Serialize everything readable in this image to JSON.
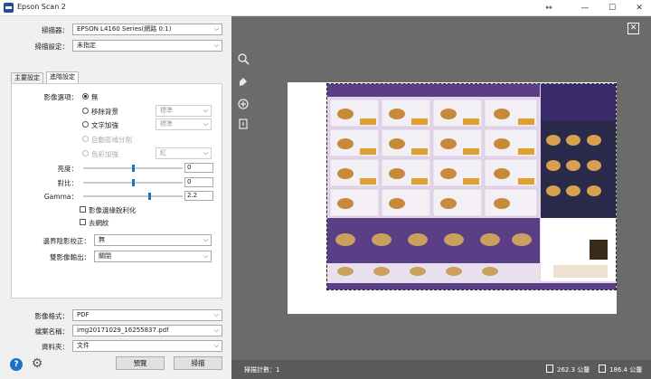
{
  "window": {
    "title": "Epson Scan 2",
    "pin_glyph": "↔",
    "minimize_glyph": "—",
    "maximize_glyph": "☐",
    "close_glyph": "✕"
  },
  "top_settings": {
    "scanner_label": "掃描器：",
    "scanner_value": "EPSON L4160 Series(網路 0:1)",
    "scan_settings_label": "掃描設定：",
    "scan_settings_value": "未指定"
  },
  "tabs": [
    {
      "label": "主要設定",
      "active": false
    },
    {
      "label": "進階設定",
      "active": true
    }
  ],
  "advanced": {
    "image_option_label": "影像選項：",
    "option_none": "無",
    "option_remove_bg": "移除背景",
    "remove_bg_value": "標準",
    "option_text_enhance": "文字加強",
    "text_enhance_value": "標準",
    "option_auto_area": "自動區域分割",
    "option_color_enhance": "色彩加強",
    "color_enhance_value": "紅",
    "brightness_label": "亮度：",
    "brightness_value": "0",
    "brightness_level": 0.5,
    "contrast_label": "對比：",
    "contrast_value": "0",
    "contrast_level": 0.5,
    "gamma_label": "Gamma：",
    "gamma_value": "2.2",
    "gamma_level": 0.66,
    "unsharp_label": "影像邊緣銳利化",
    "descreen_label": "去網紋",
    "edge_fill_label": "邊界陰影校正：",
    "edge_fill_value": "無",
    "dual_output_label": "雙影像輸出：",
    "dual_output_value": "關閉"
  },
  "bottom_settings": {
    "format_label": "影像格式：",
    "format_value": "PDF",
    "filename_label": "檔案名稱：",
    "filename_value": "img20171029_16255837.pdf",
    "folder_label": "資料夾：",
    "folder_value": "文件"
  },
  "buttons": {
    "help_glyph": "?",
    "settings_glyph": "⚙",
    "preview": "預覽",
    "scan": "掃描"
  },
  "preview_tools": {
    "close_glyph": "✕"
  },
  "status": {
    "scan_count": "掃描計數：1",
    "width_value": "262.3 公釐",
    "height_value": "186.4 公釐"
  },
  "colors": {
    "accent": "#1a73c8",
    "preview_bg": "#6b6b6b",
    "scan_bg": "#d9cbe0"
  }
}
